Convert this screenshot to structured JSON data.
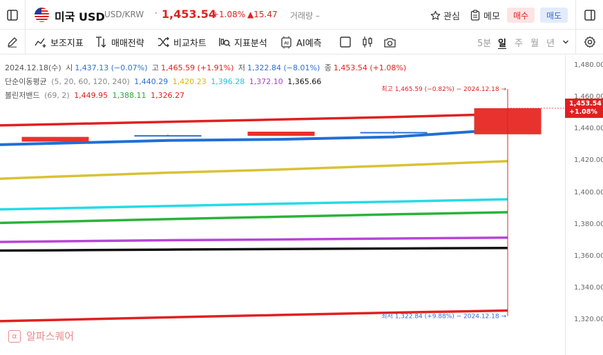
{
  "header": {
    "title": "미국 USD",
    "symbol": "USD/KRW",
    "dot": "·",
    "price": "1,453.54",
    "change_pct": "+1.08%",
    "change_abs": "▲15.47",
    "volume": "거래량 –",
    "favorite_label": "관심",
    "memo_label": "메모",
    "buy_label": "매수",
    "sell_label": "매도"
  },
  "toolbar": {
    "indicators_label": "보조지표",
    "strategy_label": "매매전략",
    "compare_label": "비교차트",
    "analysis_label": "지표분석",
    "ai_label": "AI예측",
    "periods": [
      "5분",
      "일",
      "주",
      "월",
      "년"
    ],
    "active_period": "일"
  },
  "legend": {
    "ohlc": {
      "date": "2024.12.18(수)",
      "open_label": "시",
      "open": "1,437.13 (−0.07%)",
      "high_label": "고",
      "high": "1,465.59 (+1.91%)",
      "low_label": "저",
      "low": "1,322.84 (−8.01%)",
      "close_label": "종",
      "close": "1,453.54 (+1.08%)"
    },
    "ma": {
      "label": "단순이동평균",
      "params": "(5, 20, 60, 120, 240)",
      "v1": "1,440.29",
      "v2": "1,420.23",
      "v3": "1,396.28",
      "v4": "1,372.10",
      "v5": "1,365.66"
    },
    "bb": {
      "label": "볼린저밴드",
      "params": "(69, 2)",
      "upper": "1,449.95",
      "middle": "1,388.11",
      "lower": "1,326.27"
    }
  },
  "chart_data": {
    "type": "line",
    "ylim": [
      1310,
      1490
    ],
    "yticks": [
      "1,480.00",
      "1,460.00",
      "1,440.00",
      "1,420.00",
      "1,400.00",
      "1,380.00",
      "1,360.00",
      "1,340.00",
      "1,320.00"
    ],
    "ytick_values": [
      1480,
      1460,
      1440,
      1420,
      1400,
      1380,
      1360,
      1340,
      1320
    ],
    "current_price_tag": "1,453.54",
    "current_pct_tag": "+1.08%",
    "annotations": {
      "high": "최고 1,465.59 (−0.82%) − 2024.12.18 →",
      "low": "최저 1,322.84 (+9.88%) − 2024.12.18 →"
    },
    "candles": [
      {
        "open": 1435.5,
        "close": 1432.5,
        "high": 1435.5,
        "low": 1432.5,
        "color": "#e8322e"
      },
      {
        "open": 1436,
        "close": 1436.6,
        "high": 1437,
        "low": 1436,
        "color": "#2c6fd6"
      },
      {
        "open": 1438.8,
        "close": 1436.2,
        "high": 1438.8,
        "low": 1436.2,
        "color": "#e8322e"
      },
      {
        "open": 1438.6,
        "close": 1437.8,
        "high": 1439.2,
        "low": 1437.2,
        "color": "#2c6fd6"
      },
      {
        "open": 1437.13,
        "close": 1453.54,
        "high": 1453.6,
        "low": 1437.13,
        "color": "#e8322e"
      }
    ],
    "series": [
      {
        "color": "#e02020",
        "values": [
          1443.5,
          1445.0,
          1446.5,
          1448.0,
          1449.95
        ]
      },
      {
        "color": "#1f6fd6",
        "values": [
          1431.5,
          1433.3,
          1434.0,
          1435.5,
          1440.29
        ]
      },
      {
        "color": "#d9c235",
        "values": [
          1410.5,
          1413.0,
          1415.0,
          1417.5,
          1420.23
        ]
      },
      {
        "color": "#25dbe6",
        "values": [
          1390.6,
          1392.0,
          1393.5,
          1394.8,
          1396.28
        ]
      },
      {
        "color": "#2ab33a",
        "values": [
          1382.2,
          1383.8,
          1385.3,
          1386.8,
          1388.11
        ]
      },
      {
        "color": "#b845d8",
        "values": [
          1369.8,
          1370.5,
          1371.0,
          1371.6,
          1372.1
        ]
      },
      {
        "color": "#111111",
        "values": [
          1364.2,
          1364.6,
          1365.0,
          1365.3,
          1365.66
        ]
      },
      {
        "color": "#e02020",
        "values": [
          1320.4,
          1322.0,
          1323.5,
          1325.0,
          1326.27
        ]
      }
    ]
  },
  "watermark": {
    "icon": "α",
    "text": "알파스퀘어"
  }
}
